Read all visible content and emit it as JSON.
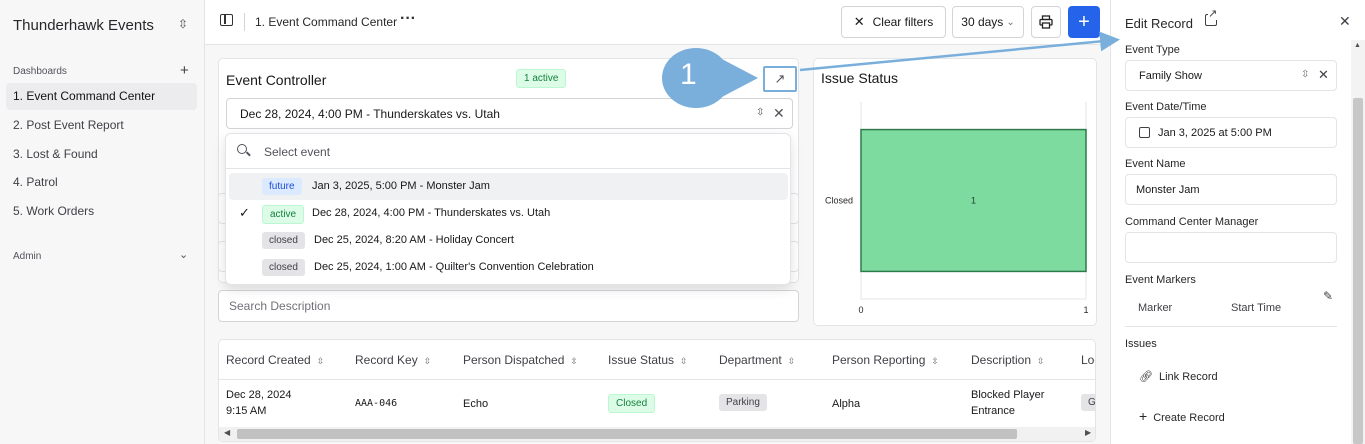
{
  "sidebar": {
    "app_title": "Thunderhawk Events",
    "dashboards_label": "Dashboards",
    "items": [
      {
        "label": "1. Event Command Center"
      },
      {
        "label": "2. Post Event Report"
      },
      {
        "label": "3. Lost & Found"
      },
      {
        "label": "4. Patrol"
      },
      {
        "label": "5. Work Orders"
      }
    ],
    "admin_label": "Admin"
  },
  "topbar": {
    "title": "1. Event Command Center",
    "clear_filters": "Clear filters",
    "days": "30 days"
  },
  "event_controller": {
    "title": "Event Controller",
    "active_count": "1 active",
    "selected": "Dec 28, 2024, 4:00 PM - Thunderskates vs. Utah",
    "dropdown": {
      "search_placeholder": "Select event",
      "options": [
        {
          "status": "future",
          "label": "Jan 3, 2025, 5:00 PM - Monster Jam"
        },
        {
          "status": "active",
          "label": "Dec 28, 2024, 4:00 PM - Thunderskates vs. Utah"
        },
        {
          "status": "closed",
          "label": "Dec 25, 2024, 8:20 AM - Holiday Concert"
        },
        {
          "status": "closed",
          "label": "Dec 25, 2024, 1:00 AM - Quilter's Convention Celebration"
        }
      ]
    },
    "search_description_placeholder": "Search Description"
  },
  "issue_status": {
    "title": "Issue Status"
  },
  "chart_data": {
    "type": "bar",
    "orientation": "horizontal",
    "categories": [
      "Closed"
    ],
    "values": [
      1
    ],
    "data_labels": [
      "1"
    ],
    "xlim": [
      0,
      1
    ],
    "x_ticks": [
      "0",
      "1"
    ],
    "bar_color": "#7ddb9f",
    "title": "Issue Status"
  },
  "table": {
    "columns": [
      "Record Created",
      "Record Key",
      "Person Dispatched",
      "Issue Status",
      "Department",
      "Person Reporting",
      "Description",
      "Loc"
    ],
    "rows": [
      {
        "created_date": "Dec 28, 2024",
        "created_time": "9:15 AM",
        "key": "AAA-046",
        "dispatched": "Echo",
        "status": "Closed",
        "department": "Parking",
        "reporting": "Alpha",
        "description_1": "Blocked Player",
        "description_2": "Entrance",
        "loc": "G"
      }
    ]
  },
  "edit_record": {
    "title": "Edit Record",
    "event_type_label": "Event Type",
    "event_type_value": "Family Show",
    "event_datetime_label": "Event Date/Time",
    "event_datetime_value": "Jan 3, 2025 at 5:00 PM",
    "event_name_label": "Event Name",
    "event_name_value": "Monster Jam",
    "manager_label": "Command Center Manager",
    "markers_label": "Event Markers",
    "marker_col": "Marker",
    "start_time_col": "Start Time",
    "issues_label": "Issues",
    "link_record": "Link Record",
    "create_record": "Create Record"
  },
  "annotation": {
    "number": "1"
  },
  "colors": {
    "accent": "#2563eb",
    "annotation": "#7aafdc",
    "active_green": "#15803d",
    "future_blue": "#1d4ed8"
  }
}
